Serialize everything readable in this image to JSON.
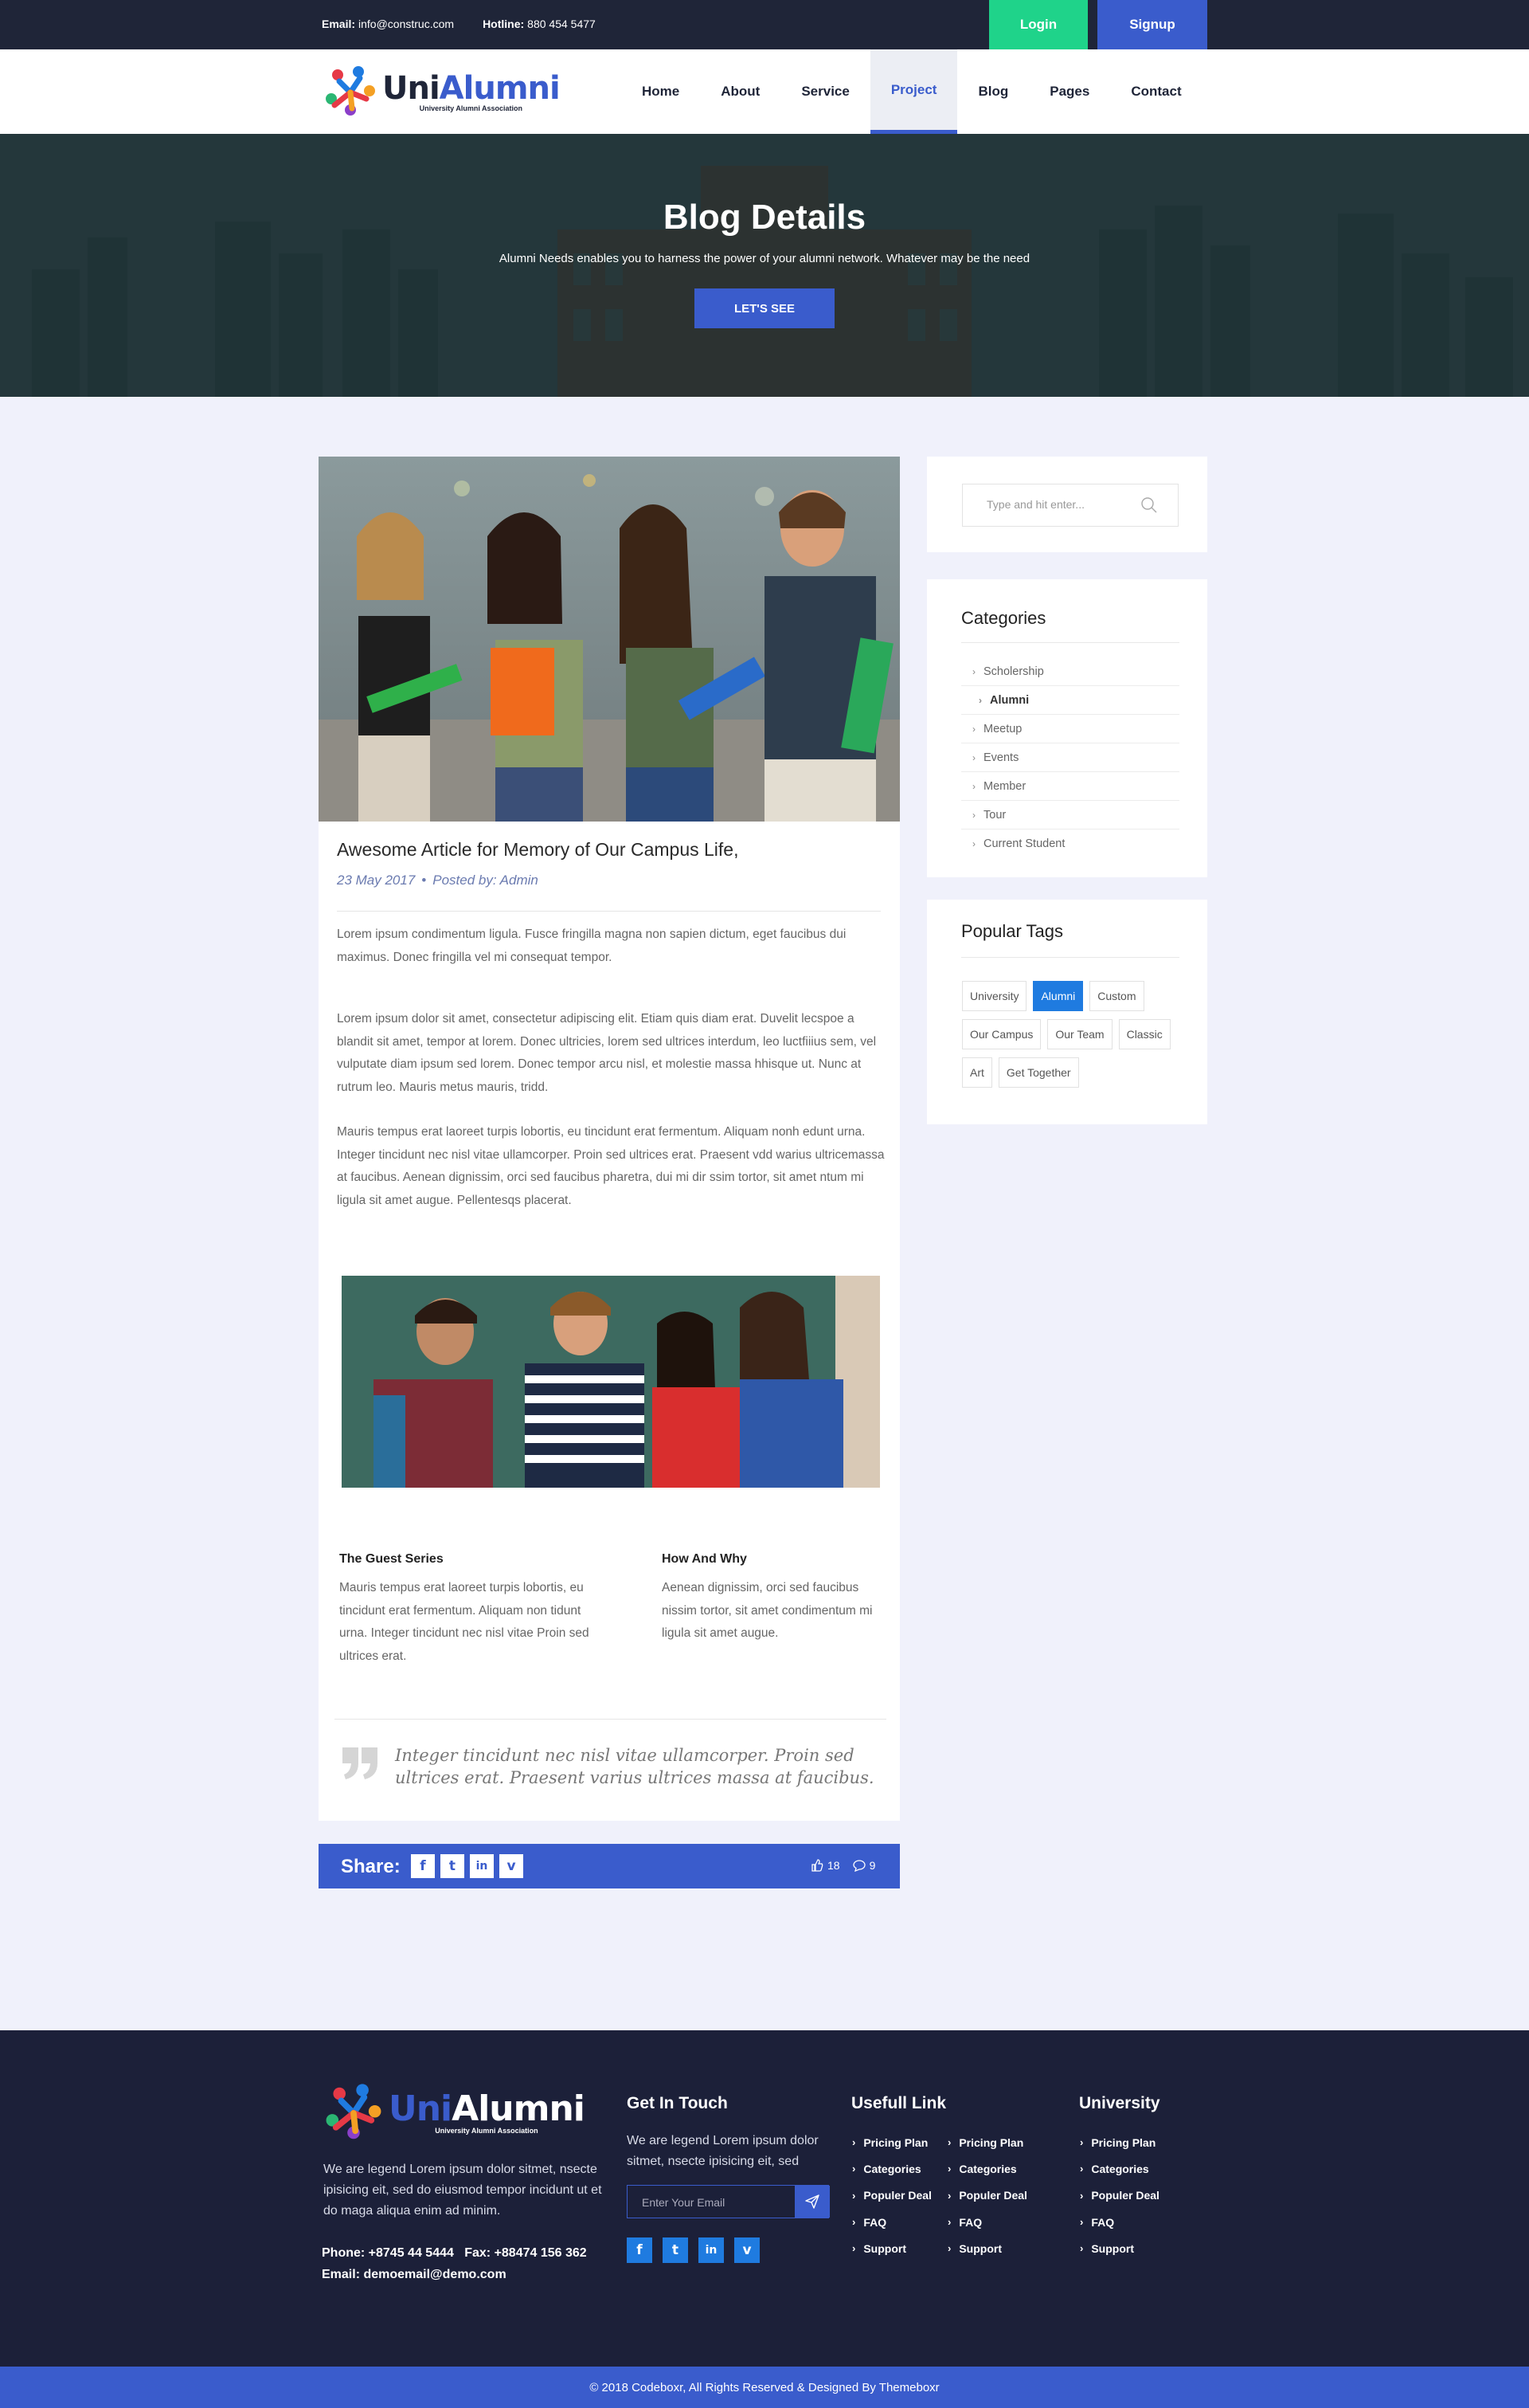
{
  "topbar": {
    "email_label": "Email:",
    "email_value": "info@construc.com",
    "hotline_label": "Hotline:",
    "hotline_value": "880 454 5477",
    "login_label": "Login",
    "signup_label": "Signup"
  },
  "logo": {
    "uni": "Uni",
    "alumni": "Alumni",
    "tagline": "University Alumni Association"
  },
  "nav": {
    "items": [
      "Home",
      "About",
      "Service",
      "Project",
      "Blog",
      "Pages",
      "Contact"
    ],
    "active": "Project"
  },
  "hero": {
    "title": "Blog Details",
    "subtitle": "Alumni Needs enables you to harness the power of your alumni network. Whatever may be the need",
    "button_label": "LET'S SEE"
  },
  "article": {
    "title": "Awesome Article for Memory of Our Campus Life,",
    "date": "23 May 2017",
    "separator": "•",
    "posted_by": "Posted by: Admin",
    "intro": "Lorem ipsum condimentum ligula. Fusce fringilla magna non sapien dictum, eget faucibus dui maximus. Donec fringilla vel mi consequat tempor.",
    "para1": "Lorem ipsum dolor sit amet, consectetur adipiscing elit. Etiam quis diam erat. Duvelit lecspoe a blandit sit amet, tempor at lorem. Donec ultricies, lorem sed ultrices interdum, leo  luctfiiius sem, vel vulputate diam ipsum sed lorem. Donec tempor arcu nisl, et molestie massa hhisque ut. Nunc at rutrum leo. Mauris metus mauris, tridd.",
    "para2": "Mauris tempus erat laoreet turpis lobortis, eu tincidunt erat fermentum. Aliquam nonh edunt urna. Integer tincidunt nec nisl vitae ullamcorper. Proin sed ultrices erat. Praesent vdd warius ultricemassa at faucibus. Aenean dignissim, orci sed faucibus pharetra, dui mi dir ssim tortor, sit amet ntum mi ligula sit amet augue. Pellentesqs placerat.",
    "col1_title": "The Guest Series",
    "col1_text": "Mauris tempus erat laoreet turpis lobortis, eu tincidunt erat fermentum. Aliquam non tidunt urna. Integer tincidunt nec nisl vitae Proin sed ultrices erat.",
    "col2_title": "How And Why",
    "col2_text": "Aenean dignissim, orci sed faucibus nissim tortor, sit amet condimentum mi ligula sit amet augue.",
    "quote": "Integer tincidunt nec nisl vitae ullamcorper. Proin sed ultrices erat. Praesent varius ultrices massa at faucibus."
  },
  "share": {
    "label": "Share:",
    "icons": [
      "f",
      "t",
      "in",
      "v"
    ],
    "likes": "18",
    "comments": "9"
  },
  "sidebar": {
    "search_placeholder": "Type and hit enter...",
    "categories_title": "Categories",
    "categories": [
      "Scholership",
      "Alumni",
      "Meetup",
      "Events",
      "Member",
      "Tour",
      "Current Student"
    ],
    "active_category": "Alumni",
    "tags_title": "Popular Tags",
    "tags": [
      "University",
      "Alumni",
      "Custom",
      "Our Campus",
      "Our Team",
      "Classic",
      "Art",
      "Get Together"
    ],
    "active_tag": "Alumni"
  },
  "footer": {
    "description": "We are legend Lorem ipsum dolor sitmet, nsecte ipisicing eit, sed do eiusmod tempor incidunt ut et do maga aliqua enim ad minim.",
    "phone": "Phone: +8745 44 5444   Fax: +88474 156 362",
    "email": "Email: demoemail@demo.com",
    "get_in_touch_title": "Get In Touch",
    "get_in_touch_text": "We are legend Lorem ipsum dolor sitmet, nsecte ipisicing eit, sed",
    "email_placeholder": "Enter Your Email",
    "social": [
      "f",
      "t",
      "in",
      "v"
    ],
    "useful_title": "Usefull Link",
    "useful_col1": [
      "Pricing Plan",
      "Categories",
      "Populer Deal",
      "FAQ",
      "Support"
    ],
    "useful_col2": [
      "Pricing Plan",
      "Categories",
      "Populer Deal",
      "FAQ",
      "Support"
    ],
    "university_title": "University",
    "university_links": [
      "Pricing Plan",
      "Categories",
      "Populer Deal",
      "FAQ",
      "Support"
    ],
    "copyright": "© 2018 Codeboxr, All Rights Reserved & Designed By Themeboxr"
  },
  "colors": {
    "primary": "#3a5ccc",
    "login": "#1fd38a",
    "dark": "#1f2538",
    "footer": "#1c2039",
    "tag_active": "#1f7be0"
  }
}
